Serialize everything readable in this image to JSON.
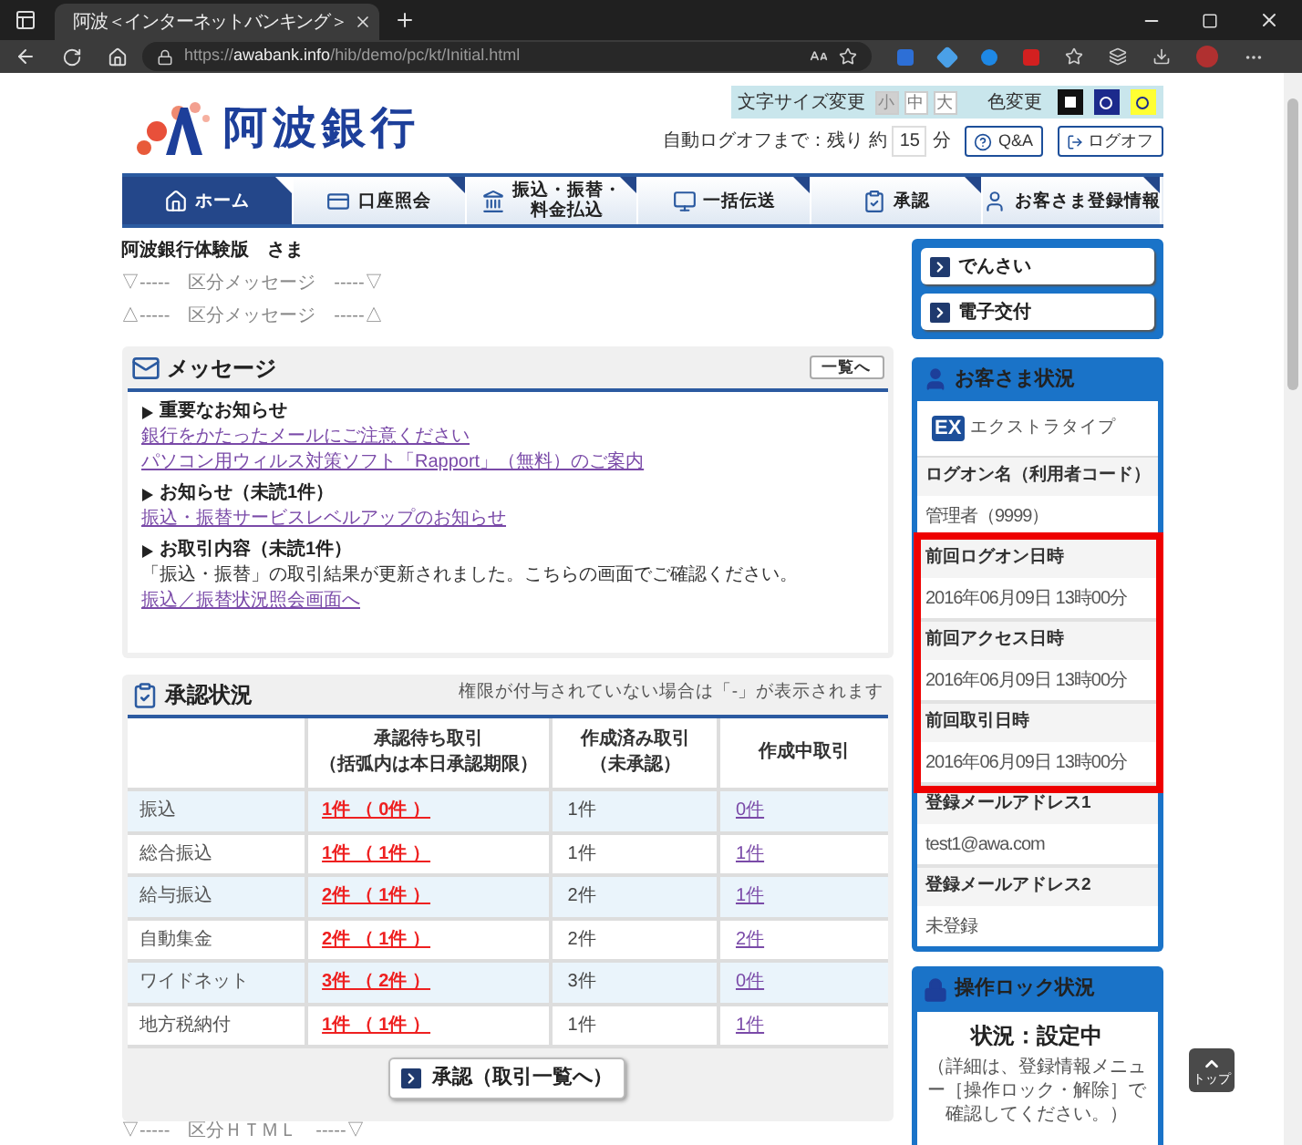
{
  "browser": {
    "tab_title": "阿波＜インターネットバンキング＞",
    "url": {
      "scheme": "https://",
      "host": "awabank.info",
      "path": "/hib/demo/pc/kt/Initial.html"
    }
  },
  "header": {
    "bank_name": "阿波銀行",
    "font_size": {
      "label": "文字サイズ変更",
      "options": [
        {
          "label": "小",
          "selected": true
        },
        {
          "label": "中",
          "selected": false
        },
        {
          "label": "大",
          "selected": false
        }
      ]
    },
    "color_change": {
      "label": "色変更",
      "options": [
        {
          "color": "#111111"
        },
        {
          "color": "#1c2a8c"
        },
        {
          "color": "#ffff33"
        }
      ]
    },
    "auto_logoff": {
      "prefix": "自動ログオフまで：残り 約",
      "minutes": "15",
      "unit": "分"
    },
    "buttons": [
      {
        "kind": "help",
        "label": "Q&A"
      },
      {
        "kind": "logoff",
        "label": "ログオフ"
      }
    ]
  },
  "nav": [
    {
      "lines": [
        "ホーム"
      ],
      "selected": true
    },
    {
      "lines": [
        "口座照会"
      ],
      "selected": false
    },
    {
      "lines": [
        "振込・振替・",
        "料金払込"
      ],
      "selected": false
    },
    {
      "lines": [
        "一括伝送"
      ],
      "selected": false
    },
    {
      "lines": [
        "承認"
      ],
      "selected": false
    },
    {
      "lines": [
        "お客さま登録情報"
      ],
      "selected": false
    }
  ],
  "greeting": {
    "name_line": "阿波銀行体験版　さま",
    "notices": [
      "▽-----　区分メッセージ　-----▽",
      "△-----　区分メッセージ　-----△"
    ]
  },
  "messages": {
    "title": "メッセージ",
    "list_button": "一覧へ",
    "sections": [
      {
        "heading": "重要なお知らせ",
        "items": [
          {
            "kind": "link",
            "text": "銀行をかたったメールにご注意ください"
          },
          {
            "kind": "link",
            "text": "パソコン用ウィルス対策ソフト「Rapport」（無料）のご案内"
          }
        ]
      },
      {
        "heading": "お知らせ（未読1件）",
        "items": [
          {
            "kind": "link",
            "text": "振込・振替サービスレベルアップのお知らせ"
          }
        ]
      },
      {
        "heading": "お取引内容（未読1件）",
        "items": [
          {
            "kind": "text",
            "text": "「振込・振替」の取引結果が更新されました。こちらの画面でご確認ください。"
          },
          {
            "kind": "link",
            "text": "振込／振替状況照会画面へ"
          }
        ]
      }
    ]
  },
  "approval": {
    "title": "承認状況",
    "note": "権限が付与されていない場合は「-」が表示されます",
    "columns": [
      {
        "lines": [
          "承認待ち取引",
          "（括弧内は本日承認期限）"
        ]
      },
      {
        "lines": [
          "作成済み取引",
          "（未承認）"
        ]
      },
      {
        "lines": [
          "作成中取引"
        ]
      }
    ],
    "rows": [
      {
        "label": "振込",
        "pending": "1件 （ 0件 ）",
        "created": "1件",
        "in_progress": "0件"
      },
      {
        "label": "総合振込",
        "pending": "1件 （ 1件 ）",
        "created": "1件",
        "in_progress": "1件"
      },
      {
        "label": "給与振込",
        "pending": "2件 （ 1件 ）",
        "created": "2件",
        "in_progress": "1件"
      },
      {
        "label": "自動集金",
        "pending": "2件 （ 1件 ）",
        "created": "2件",
        "in_progress": "2件"
      },
      {
        "label": "ワイドネット",
        "pending": "3件 （ 2件 ）",
        "created": "3件",
        "in_progress": "0件"
      },
      {
        "label": "地方税納付",
        "pending": "1件 （ 1件 ）",
        "created": "1件",
        "in_progress": "1件"
      }
    ],
    "button": "承認（取引一覧へ）"
  },
  "footer_notice": "▽-----　区分ＨＴＭＬ　-----▽",
  "sidebar": {
    "links": [
      "でんさい",
      "電子交付"
    ],
    "customer": {
      "title": "お客さま状況",
      "plan_badge": "EX",
      "plan": "エクストラタイプ",
      "fields": [
        {
          "label": "ログオン名（利用者コード）",
          "value": "管理者（9999）"
        },
        {
          "label": "前回ログオン日時",
          "value": "2016年06月09日 13時00分"
        },
        {
          "label": "前回アクセス日時",
          "value": "2016年06月09日 13時00分"
        },
        {
          "label": "前回取引日時",
          "value": "2016年06月09日 13時00分"
        },
        {
          "label": "登録メールアドレス1",
          "value": "test1@awa.com"
        },
        {
          "label": "登録メールアドレス2",
          "value": "未登録"
        }
      ]
    },
    "lock": {
      "title": "操作ロック状況",
      "status": "状況：設定中",
      "detail": "（詳細は、登録情報メニュー［操作ロック・解除］で確認してください。）"
    }
  },
  "back_to_top": "トップ"
}
